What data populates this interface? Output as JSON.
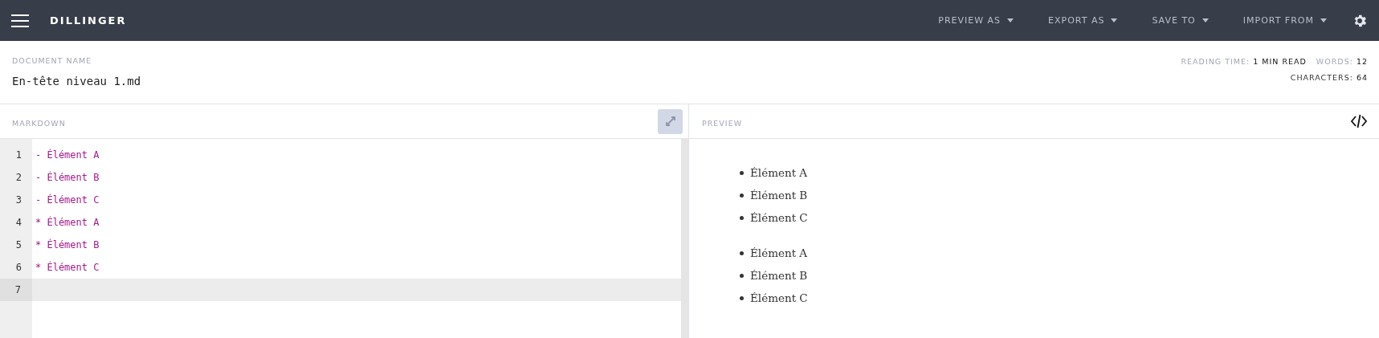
{
  "navbar": {
    "brand": "DILLINGER",
    "menus": [
      {
        "label": "PREVIEW AS"
      },
      {
        "label": "EXPORT AS"
      },
      {
        "label": "SAVE TO"
      },
      {
        "label": "IMPORT FROM"
      }
    ]
  },
  "document": {
    "label": "DOCUMENT NAME",
    "name": "En-tête niveau 1.md"
  },
  "stats": [
    {
      "label": "READING TIME:",
      "value": "1 MIN READ"
    },
    {
      "label": "WORDS:",
      "value": "12"
    },
    {
      "label": "CHARACTERS:",
      "value": "64"
    }
  ],
  "editor": {
    "title": "MARKDOWN",
    "lines": [
      {
        "number": "1",
        "text": "- Élément A",
        "current": false
      },
      {
        "number": "2",
        "text": "- Élément B",
        "current": false
      },
      {
        "number": "3",
        "text": "- Élément C",
        "current": false
      },
      {
        "number": "4",
        "text": "* Élément A",
        "current": false
      },
      {
        "number": "5",
        "text": "* Élément B",
        "current": false
      },
      {
        "number": "6",
        "text": "* Élément C",
        "current": false
      },
      {
        "number": "7",
        "current": true
      }
    ]
  },
  "preview": {
    "title": "PREVIEW",
    "lists": [
      [
        "Élément A",
        "Élément B",
        "Élément C"
      ],
      [
        "Élément A",
        "Élément B",
        "Élément C"
      ]
    ]
  }
}
